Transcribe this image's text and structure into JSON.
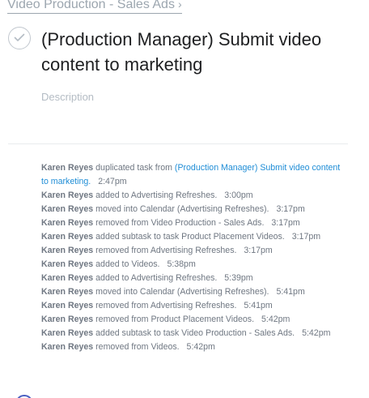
{
  "breadcrumb": {
    "label": "Video Production - Sales Ads",
    "chevron": "›"
  },
  "task": {
    "title": "(Production Manager) Submit video content to marketing",
    "description_placeholder": "Description",
    "complete_icon": "checkmark-icon"
  },
  "activity": [
    {
      "author": "Karen Reyes",
      "action": "duplicated task from",
      "link": "(Production Manager) Submit video content to marketing.",
      "time": "2:47pm"
    },
    {
      "author": "Karen Reyes",
      "action": "added to Advertising Refreshes.",
      "time": "3:00pm"
    },
    {
      "author": "Karen Reyes",
      "action": "moved into Calendar (Advertising Refreshes).",
      "time": "3:17pm"
    },
    {
      "author": "Karen Reyes",
      "action": "removed from Video Production - Sales Ads.",
      "time": "3:17pm"
    },
    {
      "author": "Karen Reyes",
      "action": "added subtask to task Product Placement Videos.",
      "time": "3:17pm"
    },
    {
      "author": "Karen Reyes",
      "action": "removed from Advertising Refreshes.",
      "time": "3:17pm"
    },
    {
      "author": "Karen Reyes",
      "action": "added to Videos.",
      "time": "5:38pm"
    },
    {
      "author": "Karen Reyes",
      "action": "added to Advertising Refreshes.",
      "time": "5:39pm"
    },
    {
      "author": "Karen Reyes",
      "action": "moved into Calendar (Advertising Refreshes).",
      "time": "5:41pm"
    },
    {
      "author": "Karen Reyes",
      "action": "removed from Advertising Refreshes.",
      "time": "5:41pm"
    },
    {
      "author": "Karen Reyes",
      "action": "removed from Product Placement Videos.",
      "time": "5:42pm"
    },
    {
      "author": "Karen Reyes",
      "action": "added subtask to task Video Production - Sales Ads.",
      "time": "5:42pm"
    },
    {
      "author": "Karen Reyes",
      "action": "removed from Videos.",
      "time": "5:42pm"
    }
  ],
  "colors": {
    "link": "#1f8dd6",
    "muted_text": "#6f7782",
    "title_text": "#1e1f21"
  }
}
